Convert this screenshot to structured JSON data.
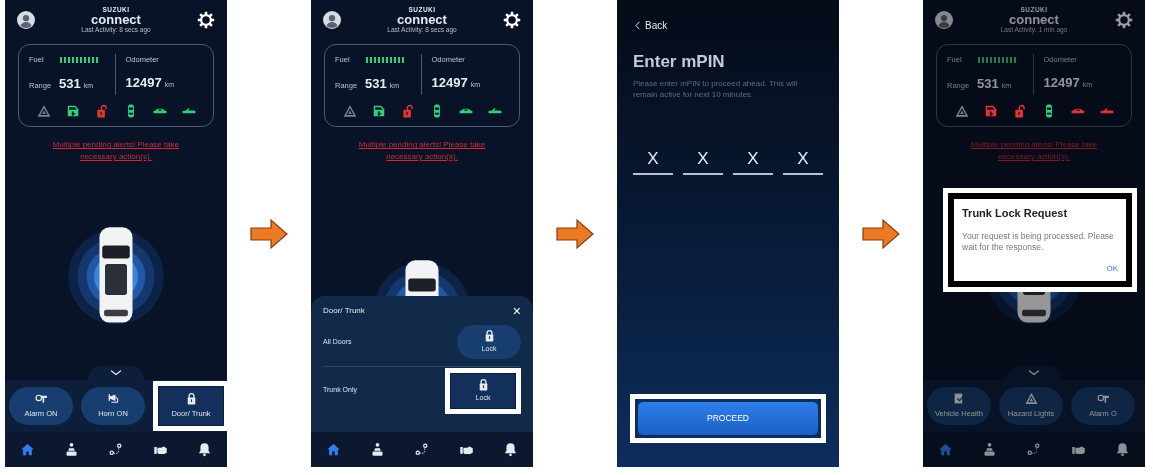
{
  "screens": [
    {
      "kind": "dashboard",
      "dimmed": false,
      "header": {
        "brand_small": "SUZUKI",
        "brand": "connect",
        "last_activity": "Last Activity: 8 secs ago"
      },
      "vehicle": {
        "fuel_label": "Fuel",
        "fuel": {
          "level": 1
        },
        "range_label": "Range",
        "range_value": "531",
        "range_unit": "km",
        "odometer_label": "Odometer",
        "odometer_value": "12497",
        "odometer_unit": "km"
      },
      "status_icons": [
        {
          "kind": "hazard",
          "color": "#7d838e"
        },
        {
          "kind": "door",
          "color": "#2fd17a"
        },
        {
          "kind": "unlock",
          "color": "#e8322f"
        },
        {
          "kind": "car-top",
          "color": "#2fd17a"
        },
        {
          "kind": "car-side",
          "color": "#2fd17a"
        },
        {
          "kind": "convertible",
          "color": "#2fd17a"
        }
      ],
      "alert": "Multiple pending alerts! Please take necessary action(s).",
      "quick_actions": [
        {
          "kind": "alarm",
          "label": "Alarm ON",
          "highlighted": false
        },
        {
          "kind": "horn",
          "label": "Horn ON",
          "highlighted": false
        },
        {
          "kind": "lock",
          "label": "Door/ Trunk",
          "highlighted": true
        }
      ],
      "nav": [
        {
          "kind": "home",
          "selected": true
        },
        {
          "kind": "driver",
          "selected": false
        },
        {
          "kind": "route",
          "selected": false
        },
        {
          "kind": "handshake",
          "selected": false
        },
        {
          "kind": "bell",
          "selected": false
        }
      ]
    },
    {
      "kind": "dashboard",
      "dimmed": false,
      "header": {
        "brand_small": "SUZUKI",
        "brand": "connect",
        "last_activity": "Last Activity: 8 secs ago"
      },
      "vehicle": {
        "fuel_label": "Fuel",
        "fuel": {
          "level": 1
        },
        "range_label": "Range",
        "range_value": "531",
        "range_unit": "km",
        "odometer_label": "Odometer",
        "odometer_value": "12497",
        "odometer_unit": "km"
      },
      "status_icons": [
        {
          "kind": "hazard",
          "color": "#7d838e"
        },
        {
          "kind": "door",
          "color": "#2fd17a"
        },
        {
          "kind": "unlock",
          "color": "#e8322f"
        },
        {
          "kind": "car-top",
          "color": "#2fd17a"
        },
        {
          "kind": "car-side",
          "color": "#2fd17a"
        },
        {
          "kind": "convertible",
          "color": "#2fd17a"
        }
      ],
      "alert": "Multiple pending alerts! Please take necessary action(s).",
      "sheet": {
        "title": "Door/ Trunk",
        "close": "×",
        "rows": [
          {
            "label": "All Doors",
            "button": "Lock",
            "highlighted": false
          },
          {
            "label": "Trunk Only",
            "button": "Lock",
            "highlighted": true
          }
        ]
      },
      "nav": [
        {
          "kind": "home",
          "selected": true
        },
        {
          "kind": "driver",
          "selected": false
        },
        {
          "kind": "route",
          "selected": false
        },
        {
          "kind": "handshake",
          "selected": false
        },
        {
          "kind": "bell",
          "selected": false
        }
      ]
    },
    {
      "kind": "mpin",
      "back": "Back",
      "title": "Enter mPIN",
      "description": "Please enter mPIN to proceed ahead. This will remain active for next 10 minutes.",
      "digits": [
        "X",
        "X",
        "X",
        "X"
      ],
      "proceed": {
        "label": "PROCEED",
        "highlighted": true
      }
    },
    {
      "kind": "dashboard",
      "dimmed": true,
      "header": {
        "brand_small": "SUZUKI",
        "brand": "connect",
        "last_activity": "Last Activity: 1 min ago"
      },
      "vehicle": {
        "fuel_label": "Fuel",
        "fuel": {
          "level": 1
        },
        "range_label": "Range",
        "range_value": "531",
        "range_unit": "km",
        "odometer_label": "Odometer",
        "odometer_value": "12497",
        "odometer_unit": "km"
      },
      "status_icons": [
        {
          "kind": "hazard",
          "color": "#7d838e"
        },
        {
          "kind": "door",
          "color": "#e8322f"
        },
        {
          "kind": "unlock",
          "color": "#e8322f"
        },
        {
          "kind": "car-top",
          "color": "#2fd17a"
        },
        {
          "kind": "car-side",
          "color": "#e8322f"
        },
        {
          "kind": "convertible",
          "color": "#e8322f"
        }
      ],
      "alert": "Multiple pending alerts! Please take necessary action(s).",
      "quick_actions": [
        {
          "kind": "clipboard",
          "label": "Vehicle Health",
          "highlighted": false
        },
        {
          "kind": "hazard",
          "label": "Hazard Lights",
          "highlighted": false
        },
        {
          "kind": "alarm",
          "label": "Alarm O",
          "highlighted": false
        }
      ],
      "dialog": {
        "title": "Trunk Lock Request",
        "body": "Your request is being processed. Please wait for the response.",
        "button": "OK",
        "highlighted": true
      },
      "nav": [
        {
          "kind": "home",
          "selected": true
        },
        {
          "kind": "driver",
          "selected": false
        },
        {
          "kind": "route",
          "selected": false
        },
        {
          "kind": "handshake",
          "selected": false
        },
        {
          "kind": "bell",
          "selected": false
        }
      ]
    }
  ]
}
